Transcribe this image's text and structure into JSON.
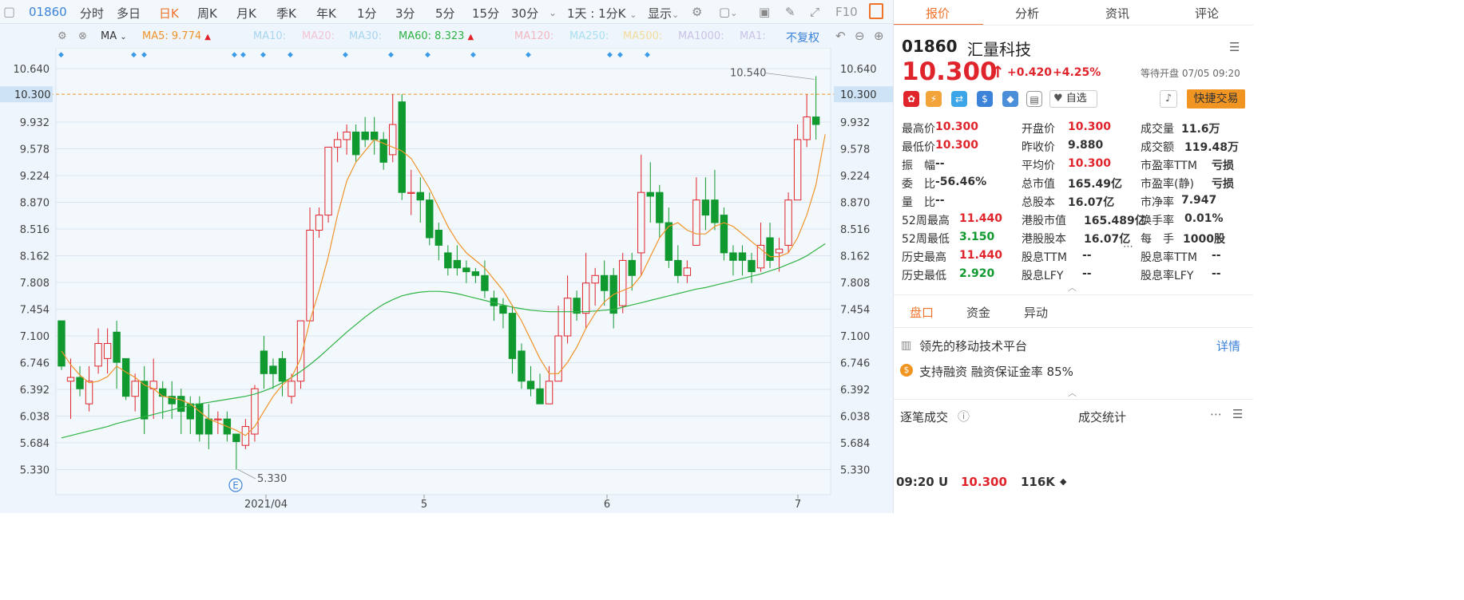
{
  "toolbar": {
    "code": "01860",
    "items": [
      "分时",
      "多日",
      "日K",
      "周K",
      "月K",
      "季K",
      "年K",
      "1分",
      "3分",
      "5分",
      "15分",
      "30分"
    ],
    "selected": "日K",
    "period": "1天 : 1分K",
    "display": "显示",
    "f10": "F10"
  },
  "ma": {
    "name": "MA",
    "ma5": {
      "label": "MA5:",
      "value": "9.774"
    },
    "ma10": "MA10:",
    "ma20": "MA20:",
    "ma30": "MA30:",
    "ma60": {
      "label": "MA60:",
      "value": "8.323"
    },
    "ma120": "MA120:",
    "ma250": "MA250:",
    "ma500": "MA500:",
    "ma1000": "MA1000:",
    "ma1": "MA1:",
    "restore": "不复权"
  },
  "colors": {
    "up": "#e0242b",
    "down": "#10992f",
    "ma5": "#f0932b",
    "ma60": "#2fb344",
    "accent": "#f0732b",
    "grid": "#d9e4ef"
  },
  "chart_data": {
    "type": "candlestick",
    "y_ticks": [
      "10.640",
      "10.300",
      "9.932",
      "9.578",
      "9.224",
      "8.870",
      "8.516",
      "8.162",
      "7.808",
      "7.454",
      "7.100",
      "6.746",
      "6.392",
      "6.038",
      "5.684",
      "5.330"
    ],
    "current_price": "10.300",
    "max_label": "10.540",
    "min_label": "5.330",
    "x_labels": [
      "2021/04",
      "5",
      "6",
      "7"
    ],
    "event_marker": "E",
    "candles": [
      [
        7.3,
        6.7,
        7.3,
        6.65
      ],
      [
        6.5,
        6.55,
        6.8,
        6.0
      ],
      [
        6.55,
        6.4,
        6.7,
        6.3
      ],
      [
        6.2,
        6.5,
        6.7,
        6.1
      ],
      [
        6.7,
        7.0,
        7.2,
        6.6
      ],
      [
        6.8,
        7.0,
        7.2,
        6.6
      ],
      [
        7.15,
        6.75,
        7.3,
        6.4
      ],
      [
        6.8,
        6.3,
        6.8,
        6.25
      ],
      [
        6.3,
        6.5,
        6.6,
        6.1
      ],
      [
        6.5,
        6.0,
        6.7,
        5.8
      ],
      [
        6.4,
        6.5,
        6.8,
        6.0
      ],
      [
        6.4,
        6.3,
        6.5,
        6.0
      ],
      [
        6.3,
        6.2,
        6.5,
        6.0
      ],
      [
        6.3,
        6.1,
        6.4,
        5.8
      ],
      [
        6.2,
        6.0,
        6.3,
        5.8
      ],
      [
        6.2,
        5.8,
        6.3,
        5.7
      ],
      [
        6.0,
        5.8,
        6.2,
        5.6
      ],
      [
        6.0,
        6.0,
        6.1,
        5.8
      ],
      [
        6.0,
        5.8,
        6.1,
        5.7
      ],
      [
        5.8,
        5.7,
        5.8,
        5.33
      ],
      [
        5.65,
        5.9,
        6.0,
        5.6
      ],
      [
        5.8,
        6.4,
        6.45,
        5.7
      ],
      [
        6.9,
        6.6,
        7.1,
        6.4
      ],
      [
        6.7,
        6.6,
        6.8,
        6.4
      ],
      [
        6.8,
        6.5,
        6.9,
        6.3
      ],
      [
        6.3,
        6.5,
        6.6,
        6.2
      ],
      [
        6.5,
        7.3,
        7.3,
        6.4
      ],
      [
        7.3,
        8.5,
        8.8,
        7.3
      ],
      [
        8.5,
        8.7,
        8.8,
        8.4
      ],
      [
        8.7,
        9.6,
        9.6,
        8.6
      ],
      [
        9.6,
        9.7,
        9.8,
        9.4
      ],
      [
        9.7,
        9.8,
        9.9,
        9.5
      ],
      [
        9.8,
        9.5,
        9.9,
        9.4
      ],
      [
        9.8,
        9.7,
        10.0,
        9.6
      ],
      [
        9.8,
        9.7,
        10.0,
        9.5
      ],
      [
        9.7,
        9.4,
        9.8,
        9.3
      ],
      [
        9.5,
        9.9,
        10.3,
        9.4
      ],
      [
        10.2,
        9.0,
        10.3,
        8.9
      ],
      [
        9.0,
        9.0,
        9.3,
        8.7
      ],
      [
        9.0,
        8.9,
        9.2,
        8.6
      ],
      [
        8.9,
        8.4,
        9.0,
        8.3
      ],
      [
        8.5,
        8.3,
        8.6,
        8.1
      ],
      [
        8.2,
        8.0,
        8.3,
        7.9
      ],
      [
        8.1,
        8.0,
        8.3,
        7.9
      ],
      [
        8.0,
        7.95,
        8.1,
        7.8
      ],
      [
        7.95,
        7.9,
        8.0,
        7.8
      ],
      [
        7.9,
        7.7,
        8.1,
        7.6
      ],
      [
        7.6,
        7.5,
        7.7,
        7.3
      ],
      [
        7.5,
        7.4,
        7.6,
        7.2
      ],
      [
        7.4,
        6.8,
        7.5,
        6.6
      ],
      [
        6.9,
        6.5,
        7.0,
        6.4
      ],
      [
        6.5,
        6.4,
        6.7,
        6.3
      ],
      [
        6.4,
        6.2,
        6.6,
        6.2
      ],
      [
        6.2,
        6.5,
        6.7,
        6.2
      ],
      [
        6.5,
        7.1,
        7.5,
        6.5
      ],
      [
        7.1,
        7.6,
        7.9,
        7.0
      ],
      [
        7.6,
        7.4,
        7.7,
        7.3
      ],
      [
        7.4,
        7.8,
        8.2,
        7.2
      ],
      [
        7.8,
        7.9,
        8.0,
        7.5
      ],
      [
        7.9,
        7.7,
        8.1,
        7.5
      ],
      [
        7.9,
        7.4,
        8.0,
        7.2
      ],
      [
        7.5,
        8.1,
        8.2,
        7.4
      ],
      [
        8.1,
        7.9,
        8.2,
        7.7
      ],
      [
        8.2,
        9.0,
        9.5,
        7.9
      ],
      [
        9.0,
        8.95,
        9.4,
        8.6
      ],
      [
        9.0,
        8.6,
        9.1,
        8.4
      ],
      [
        8.6,
        8.1,
        8.8,
        8.0
      ],
      [
        8.1,
        7.9,
        8.3,
        7.8
      ],
      [
        7.9,
        8.0,
        8.1,
        7.8
      ],
      [
        8.3,
        8.9,
        9.2,
        8.3
      ],
      [
        8.9,
        8.7,
        9.2,
        8.5
      ],
      [
        8.9,
        8.6,
        9.3,
        8.5
      ],
      [
        8.7,
        8.2,
        8.8,
        8.1
      ],
      [
        8.2,
        8.1,
        8.3,
        7.9
      ],
      [
        8.2,
        8.1,
        8.3,
        7.9
      ],
      [
        8.1,
        7.95,
        8.2,
        7.8
      ],
      [
        8.0,
        8.3,
        8.6,
        7.95
      ],
      [
        8.4,
        8.1,
        8.6,
        8.0
      ],
      [
        8.2,
        8.25,
        8.4,
        7.95
      ],
      [
        8.3,
        8.9,
        9.0,
        8.2
      ],
      [
        8.9,
        9.7,
        9.9,
        8.9
      ],
      [
        9.7,
        10.0,
        10.3,
        9.6
      ],
      [
        10.0,
        9.9,
        10.54,
        9.7
      ]
    ],
    "ma5": [
      6.9,
      6.72,
      6.58,
      6.48,
      6.5,
      6.56,
      6.7,
      6.62,
      6.55,
      6.45,
      6.4,
      6.3,
      6.28,
      6.25,
      6.2,
      6.1,
      6.0,
      5.95,
      5.9,
      5.85,
      5.78,
      5.9,
      6.1,
      6.3,
      6.45,
      6.55,
      6.8,
      7.3,
      7.7,
      8.15,
      8.7,
      9.15,
      9.4,
      9.55,
      9.7,
      9.65,
      9.6,
      9.55,
      9.45,
      9.25,
      9.05,
      8.8,
      8.55,
      8.35,
      8.2,
      8.1,
      8.0,
      7.85,
      7.7,
      7.5,
      7.3,
      7.05,
      6.8,
      6.6,
      6.6,
      6.75,
      6.95,
      7.2,
      7.4,
      7.55,
      7.65,
      7.7,
      7.75,
      7.9,
      8.15,
      8.4,
      8.55,
      8.6,
      8.5,
      8.45,
      8.45,
      8.55,
      8.6,
      8.55,
      8.45,
      8.35,
      8.25,
      8.15,
      8.15,
      8.2,
      8.4,
      8.7,
      9.1,
      9.77
    ],
    "ma60": [
      5.75,
      5.78,
      5.81,
      5.84,
      5.87,
      5.9,
      5.94,
      5.97,
      6.0,
      6.03,
      6.06,
      6.09,
      6.12,
      6.15,
      6.18,
      6.2,
      6.22,
      6.24,
      6.26,
      6.28,
      6.3,
      6.33,
      6.37,
      6.42,
      6.48,
      6.55,
      6.63,
      6.72,
      6.82,
      6.93,
      7.04,
      7.15,
      7.25,
      7.35,
      7.44,
      7.52,
      7.58,
      7.63,
      7.66,
      7.68,
      7.69,
      7.69,
      7.68,
      7.66,
      7.63,
      7.6,
      7.57,
      7.54,
      7.51,
      7.48,
      7.46,
      7.44,
      7.43,
      7.42,
      7.42,
      7.42,
      7.42,
      7.42,
      7.43,
      7.44,
      7.45,
      7.48,
      7.51,
      7.54,
      7.57,
      7.6,
      7.63,
      7.66,
      7.69,
      7.72,
      7.74,
      7.77,
      7.8,
      7.83,
      7.86,
      7.89,
      7.92,
      7.96,
      8.0,
      8.05,
      8.1,
      8.16,
      8.24,
      8.32
    ]
  },
  "quote": {
    "code": "01860",
    "name": "汇量科技",
    "price": "10.300",
    "arrow": "↑",
    "change": "+0.420",
    "change_pct": "+4.25%",
    "status": "等待开盘 07/05 09:20",
    "watch": "自选",
    "trade": "快捷交易"
  },
  "tabs": [
    "报价",
    "分析",
    "资讯",
    "评论"
  ],
  "fields": {
    "col1": [
      {
        "k": "最高价",
        "v": "10.300",
        "c": "red"
      },
      {
        "k": "最低价",
        "v": "10.300",
        "c": "red"
      },
      {
        "k": "振　幅",
        "v": "--",
        "c": "dk"
      },
      {
        "k": "委　比",
        "v": "-56.46%",
        "c": "dk"
      },
      {
        "k": "量　比",
        "v": "--",
        "c": "dk"
      },
      {
        "k": "52周最高",
        "v": "11.440",
        "c": "red"
      },
      {
        "k": "52周最低",
        "v": "3.150",
        "c": "green"
      },
      {
        "k": "历史最高",
        "v": "11.440",
        "c": "red"
      },
      {
        "k": "历史最低",
        "v": "2.920",
        "c": "green"
      }
    ],
    "col2": [
      {
        "k": "开盘价",
        "v": "10.300",
        "c": "red"
      },
      {
        "k": "昨收价",
        "v": "9.880",
        "c": "dk"
      },
      {
        "k": "平均价",
        "v": "10.300",
        "c": "red"
      },
      {
        "k": "总市值",
        "v": "165.49亿",
        "c": "dk"
      },
      {
        "k": "总股本",
        "v": "16.07亿",
        "c": "dk"
      },
      {
        "k": "港股市值",
        "v": "165.489亿",
        "c": "dk"
      },
      {
        "k": "港股股本",
        "v": "16.07亿",
        "c": "dk"
      },
      {
        "k": "股息TTM",
        "v": "--",
        "c": "dk"
      },
      {
        "k": "股息LFY",
        "v": "--",
        "c": "dk"
      }
    ],
    "col3": [
      {
        "k": "成交量",
        "v": "11.6万",
        "c": "dk"
      },
      {
        "k": "成交额",
        "v": "119.48万",
        "c": "dk"
      },
      {
        "k": "市盈率TTM",
        "v": "亏损",
        "c": "dk"
      },
      {
        "k": "市盈率(静)",
        "v": "亏损",
        "c": "dk"
      },
      {
        "k": "市净率",
        "v": "7.947",
        "c": "dk"
      },
      {
        "k": "换手率",
        "v": "0.01%",
        "c": "dk"
      },
      {
        "k": "每　手",
        "v": "1000股",
        "c": "dk"
      },
      {
        "k": "股息率TTM",
        "v": "--",
        "c": "dk"
      },
      {
        "k": "股息率LFY",
        "v": "--",
        "c": "dk"
      }
    ]
  },
  "subtabs": [
    "盘口",
    "资金",
    "异动"
  ],
  "profile": {
    "desc": "领先的移动技术平台",
    "detail": "详情",
    "margin": "支持融资 融资保证金率 85%"
  },
  "ticks": {
    "title": "逐笔成交",
    "stats": "成交统计",
    "time": "09:20 U",
    "price": "10.300",
    "volume": "116K"
  }
}
